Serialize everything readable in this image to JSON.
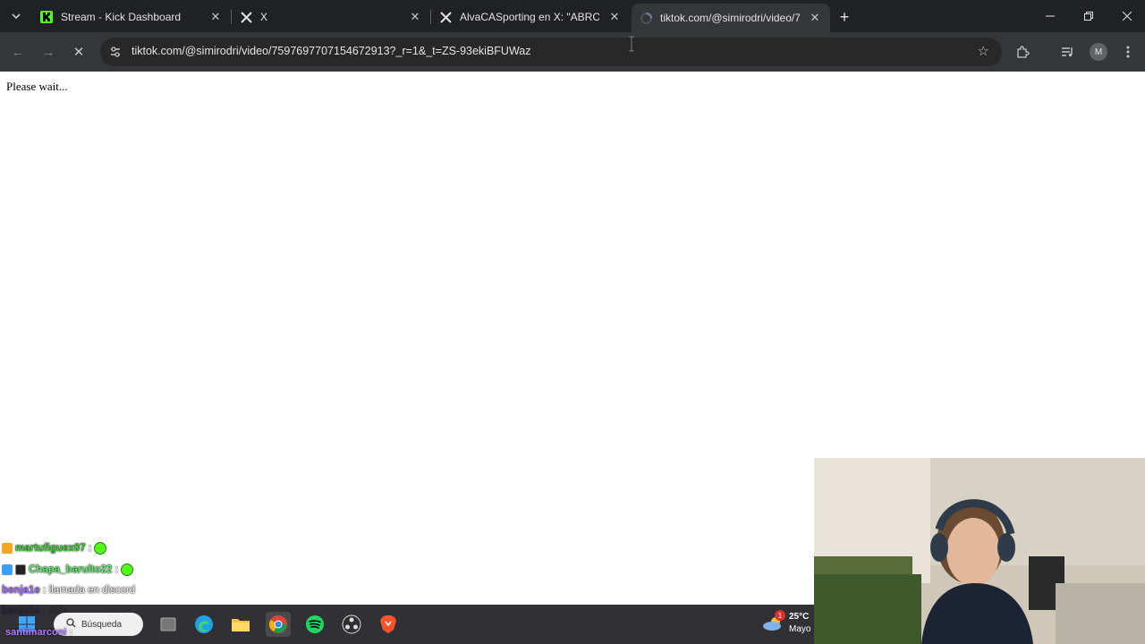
{
  "tabs": [
    {
      "title": "Stream - Kick Dashboard",
      "icon": "kick-icon"
    },
    {
      "title": "X",
      "icon": "x-icon"
    },
    {
      "title": "AlvaCASporting en X: \"ABRO H",
      "icon": "x-icon"
    },
    {
      "title": "tiktok.com/@simirodri/video/7",
      "icon": "loading-spinner-icon",
      "active": true
    }
  ],
  "address_bar": {
    "url": "tiktok.com/@simirodri/video/7597697707154672913?_r=1&_t=ZS-93ekiBFUWaz"
  },
  "profile": {
    "initial": "M"
  },
  "page": {
    "message": "Please wait..."
  },
  "chat": [
    {
      "user": "martufiguex07",
      "sep": ":",
      "text": "",
      "user_color": "#3ecf36",
      "emote": true
    },
    {
      "user": "Chapa_barulto22",
      "sep": ":",
      "text": "",
      "user_color": "#5ef06a",
      "emote": true
    },
    {
      "user": "benja1e",
      "sep": ":",
      "text": "llamada en discord",
      "user_color": "#a970ff",
      "emote": false
    },
    {
      "user": "benja1e",
      "sep": ":",
      "text": "sale",
      "user_color": "#a970ff",
      "emote": false
    },
    {
      "user": "santimarconi",
      "sep": ":",
      "text": "",
      "user_color": "#b07cff",
      "emote": false
    }
  ],
  "taskbar": {
    "search_label": "Búsqueda",
    "weather_temp": "25°C",
    "weather_desc": "Mayo",
    "notification_count": "1"
  },
  "colors": {
    "tabbar_bg": "#202124",
    "toolbar_bg": "#35363a",
    "kick_green": "#53fc18"
  }
}
